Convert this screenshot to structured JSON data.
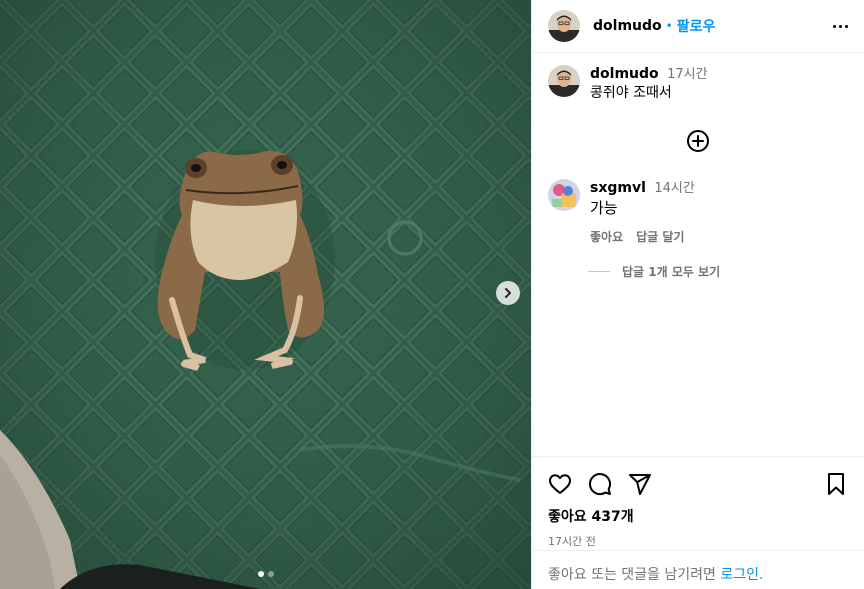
{
  "post": {
    "author": "dolmudo",
    "separator": "•",
    "follow_label": "팔로우",
    "more_icon": "more-horizontal-icon"
  },
  "caption": {
    "username": "dolmudo",
    "time": "17시간",
    "text": "콩쥐야 조때서"
  },
  "load_more_icon": "plus-circle-icon",
  "comments": [
    {
      "username": "sxgmvl",
      "time": "14시간",
      "text": "가능",
      "like_label": "좋아요",
      "reply_label": "답글 달기",
      "view_replies_label": "답글 1개 모두 보기"
    }
  ],
  "actions": {
    "icons": [
      "heart-icon",
      "comment-icon",
      "share-icon",
      "bookmark-icon"
    ],
    "likes_label": "좋아요 437개",
    "time_ago": "17시간 전"
  },
  "login_prompt": {
    "text": "좋아요 또는 댓글을 남기려면 ",
    "link": "로그인",
    "suffix": "."
  },
  "carousel": {
    "next_icon": "chevron-right-icon",
    "slide_count": 2,
    "active_index": 0
  },
  "colors": {
    "accent": "#0095f6",
    "secondary_text": "#737373",
    "divider": "#efefef",
    "photo_green": "#2f5a47"
  }
}
